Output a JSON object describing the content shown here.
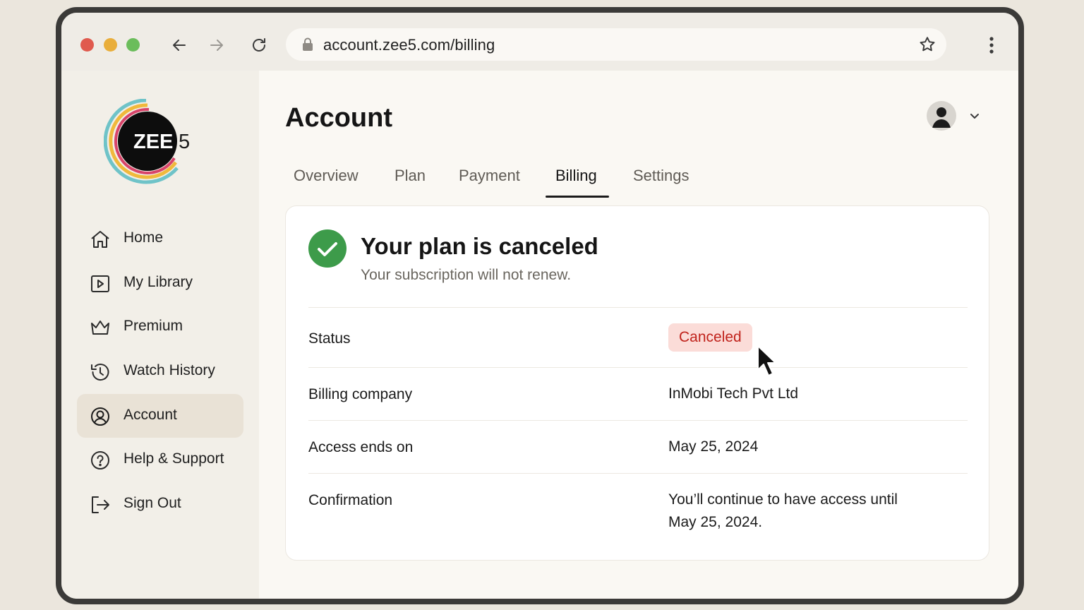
{
  "browser": {
    "url": "account.zee5.com/billing"
  },
  "brand": {
    "logo_text": "ZEE5",
    "accent": "#1b1b1b"
  },
  "sidebar": {
    "items": [
      {
        "label": "Home",
        "icon": "home-icon"
      },
      {
        "label": "My Library",
        "icon": "play-square-icon"
      },
      {
        "label": "Premium",
        "icon": "crown-icon"
      },
      {
        "label": "Watch History",
        "icon": "history-icon"
      },
      {
        "label": "Account",
        "icon": "user-circle-icon",
        "active": true
      },
      {
        "label": "Help & Support",
        "icon": "help-circle-icon"
      },
      {
        "label": "Sign Out",
        "icon": "sign-out-icon"
      }
    ]
  },
  "page": {
    "title": "Account",
    "tabs": [
      {
        "label": "Overview"
      },
      {
        "label": "Plan"
      },
      {
        "label": "Payment"
      },
      {
        "label": "Billing",
        "active": true
      },
      {
        "label": "Settings"
      }
    ]
  },
  "card": {
    "title": "Your plan is canceled",
    "subtitle": "Your subscription will not renew.",
    "success_color": "#3d9b4a",
    "rows": [
      {
        "label": "Status",
        "value": "Canceled",
        "badge_color": "#c0231c"
      },
      {
        "label": "Billing company",
        "value": "InMobi Tech Pvt Ltd"
      },
      {
        "label": "Access ends on",
        "value": "May 25, 2024"
      },
      {
        "label": "Confirmation",
        "value_line1": "You’ll continue to have access until",
        "value_line2": "May 25, 2024."
      }
    ]
  }
}
